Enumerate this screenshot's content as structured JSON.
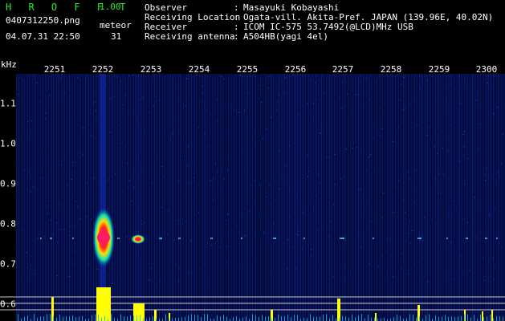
{
  "app": {
    "logo": "H R O F F T",
    "version": "1.00"
  },
  "file": {
    "name": "0407312250.png",
    "datetime": "04.07.31 22:50"
  },
  "meteor": {
    "label": "meteor",
    "count": "31"
  },
  "info": [
    {
      "key": "Observer",
      "value": "Masayuki Kobayashi"
    },
    {
      "key": "Receiving Location",
      "value": "Ogata-vill. Akita-Pref. JAPAN (139.96E, 40.02N)"
    },
    {
      "key": "Receiver",
      "value": "ICOM IC-575 53.7492(@LCD)MHz USB"
    },
    {
      "key": "Receiving antenna",
      "value": "A504HB(yagi 4el)"
    }
  ],
  "axis": {
    "unit": "kHz",
    "minutes": [
      "2251",
      "2252",
      "2253",
      "2254",
      "2255",
      "2256",
      "2257",
      "2258",
      "2259",
      "2300"
    ],
    "freq_ticks": [
      "1.1",
      "1.0",
      "0.9",
      "0.8",
      "0.7",
      "0.6"
    ]
  },
  "colors": {
    "accent": "#2ee82e",
    "text": "#ffffff",
    "bar": "#ffff00",
    "noise": "#00c8ff",
    "echo": "#ff0066"
  }
}
